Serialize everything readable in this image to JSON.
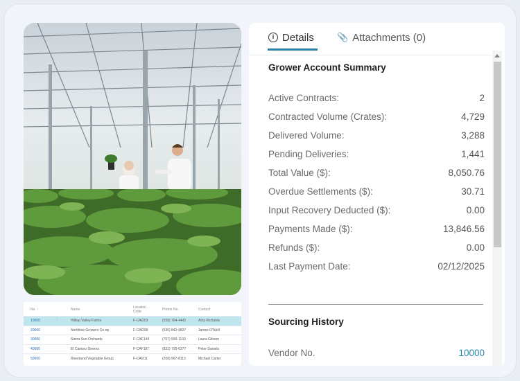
{
  "tabs": {
    "details_label": "Details",
    "attachments_label": "Attachments (0)"
  },
  "summary": {
    "title": "Grower Account Summary",
    "rows": [
      {
        "label": "Active Contracts:",
        "value": "2"
      },
      {
        "label": "Contracted Volume (Crates):",
        "value": "4,729"
      },
      {
        "label": "Delivered Volume:",
        "value": "3,288"
      },
      {
        "label": "Pending Deliveries:",
        "value": "1,441"
      },
      {
        "label": "Total Value ($):",
        "value": "8,050.76"
      },
      {
        "label": "Overdue Settlements ($):",
        "value": "30.71"
      },
      {
        "label": "Input Recovery Deducted ($):",
        "value": "0.00"
      },
      {
        "label": "Payments Made ($):",
        "value": "13,846.56"
      },
      {
        "label": "Refunds ($):",
        "value": "0.00"
      },
      {
        "label": "Last Payment Date:",
        "value": "02/12/2025"
      }
    ]
  },
  "history": {
    "title": "Sourcing History",
    "vendor_label": "Vendor No.",
    "vendor_value": "10000"
  },
  "mini_table": {
    "headers": [
      "No. ↑",
      "Name",
      "Location Code",
      "Phone No.",
      "Contact"
    ],
    "rows": [
      [
        "10000",
        "Hilltop Valley Farms",
        "F-CAI203",
        "(559) 784-4442",
        "Amy Richards"
      ],
      [
        "20000",
        "Northline Growers Co-op",
        "F-CAI299",
        "(530) 842-9827",
        "James O'Neill"
      ],
      [
        "30000",
        "Sierra Sun Orchards",
        "F-CAF144",
        "(707) 555-1133",
        "Laura Gibson"
      ],
      [
        "40000",
        "El Camino Greens",
        "F-CAF187",
        "(831) 795-6277",
        "Peter Daniels"
      ],
      [
        "50000",
        "Riverbend Vegetable Group",
        "F-CAI211",
        "(209) 567-8113",
        "Michael Carter"
      ]
    ]
  },
  "colors": {
    "accent": "#2a7fa3",
    "selected_row": "#bfe5ee",
    "background": "#e9edf4"
  }
}
